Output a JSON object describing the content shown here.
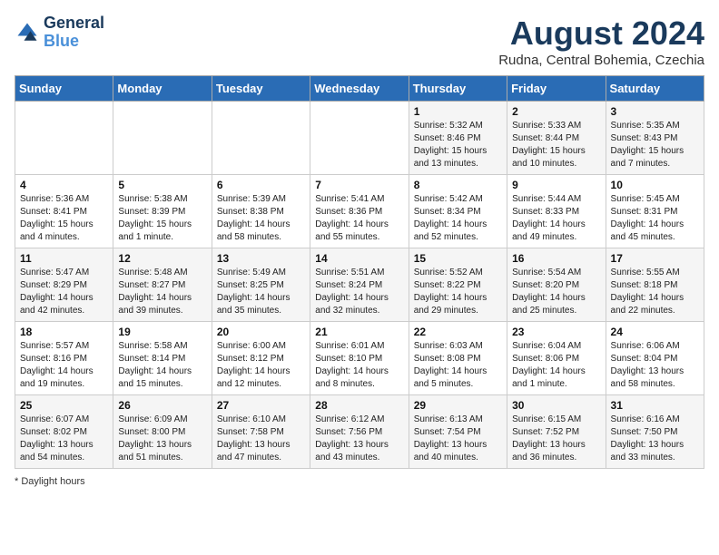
{
  "header": {
    "logo_line1": "General",
    "logo_line2": "Blue",
    "month_year": "August 2024",
    "location": "Rudna, Central Bohemia, Czechia"
  },
  "days_of_week": [
    "Sunday",
    "Monday",
    "Tuesday",
    "Wednesday",
    "Thursday",
    "Friday",
    "Saturday"
  ],
  "weeks": [
    [
      {
        "day": "",
        "info": ""
      },
      {
        "day": "",
        "info": ""
      },
      {
        "day": "",
        "info": ""
      },
      {
        "day": "",
        "info": ""
      },
      {
        "day": "1",
        "info": "Sunrise: 5:32 AM\nSunset: 8:46 PM\nDaylight: 15 hours\nand 13 minutes."
      },
      {
        "day": "2",
        "info": "Sunrise: 5:33 AM\nSunset: 8:44 PM\nDaylight: 15 hours\nand 10 minutes."
      },
      {
        "day": "3",
        "info": "Sunrise: 5:35 AM\nSunset: 8:43 PM\nDaylight: 15 hours\nand 7 minutes."
      }
    ],
    [
      {
        "day": "4",
        "info": "Sunrise: 5:36 AM\nSunset: 8:41 PM\nDaylight: 15 hours\nand 4 minutes."
      },
      {
        "day": "5",
        "info": "Sunrise: 5:38 AM\nSunset: 8:39 PM\nDaylight: 15 hours\nand 1 minute."
      },
      {
        "day": "6",
        "info": "Sunrise: 5:39 AM\nSunset: 8:38 PM\nDaylight: 14 hours\nand 58 minutes."
      },
      {
        "day": "7",
        "info": "Sunrise: 5:41 AM\nSunset: 8:36 PM\nDaylight: 14 hours\nand 55 minutes."
      },
      {
        "day": "8",
        "info": "Sunrise: 5:42 AM\nSunset: 8:34 PM\nDaylight: 14 hours\nand 52 minutes."
      },
      {
        "day": "9",
        "info": "Sunrise: 5:44 AM\nSunset: 8:33 PM\nDaylight: 14 hours\nand 49 minutes."
      },
      {
        "day": "10",
        "info": "Sunrise: 5:45 AM\nSunset: 8:31 PM\nDaylight: 14 hours\nand 45 minutes."
      }
    ],
    [
      {
        "day": "11",
        "info": "Sunrise: 5:47 AM\nSunset: 8:29 PM\nDaylight: 14 hours\nand 42 minutes."
      },
      {
        "day": "12",
        "info": "Sunrise: 5:48 AM\nSunset: 8:27 PM\nDaylight: 14 hours\nand 39 minutes."
      },
      {
        "day": "13",
        "info": "Sunrise: 5:49 AM\nSunset: 8:25 PM\nDaylight: 14 hours\nand 35 minutes."
      },
      {
        "day": "14",
        "info": "Sunrise: 5:51 AM\nSunset: 8:24 PM\nDaylight: 14 hours\nand 32 minutes."
      },
      {
        "day": "15",
        "info": "Sunrise: 5:52 AM\nSunset: 8:22 PM\nDaylight: 14 hours\nand 29 minutes."
      },
      {
        "day": "16",
        "info": "Sunrise: 5:54 AM\nSunset: 8:20 PM\nDaylight: 14 hours\nand 25 minutes."
      },
      {
        "day": "17",
        "info": "Sunrise: 5:55 AM\nSunset: 8:18 PM\nDaylight: 14 hours\nand 22 minutes."
      }
    ],
    [
      {
        "day": "18",
        "info": "Sunrise: 5:57 AM\nSunset: 8:16 PM\nDaylight: 14 hours\nand 19 minutes."
      },
      {
        "day": "19",
        "info": "Sunrise: 5:58 AM\nSunset: 8:14 PM\nDaylight: 14 hours\nand 15 minutes."
      },
      {
        "day": "20",
        "info": "Sunrise: 6:00 AM\nSunset: 8:12 PM\nDaylight: 14 hours\nand 12 minutes."
      },
      {
        "day": "21",
        "info": "Sunrise: 6:01 AM\nSunset: 8:10 PM\nDaylight: 14 hours\nand 8 minutes."
      },
      {
        "day": "22",
        "info": "Sunrise: 6:03 AM\nSunset: 8:08 PM\nDaylight: 14 hours\nand 5 minutes."
      },
      {
        "day": "23",
        "info": "Sunrise: 6:04 AM\nSunset: 8:06 PM\nDaylight: 14 hours\nand 1 minute."
      },
      {
        "day": "24",
        "info": "Sunrise: 6:06 AM\nSunset: 8:04 PM\nDaylight: 13 hours\nand 58 minutes."
      }
    ],
    [
      {
        "day": "25",
        "info": "Sunrise: 6:07 AM\nSunset: 8:02 PM\nDaylight: 13 hours\nand 54 minutes."
      },
      {
        "day": "26",
        "info": "Sunrise: 6:09 AM\nSunset: 8:00 PM\nDaylight: 13 hours\nand 51 minutes."
      },
      {
        "day": "27",
        "info": "Sunrise: 6:10 AM\nSunset: 7:58 PM\nDaylight: 13 hours\nand 47 minutes."
      },
      {
        "day": "28",
        "info": "Sunrise: 6:12 AM\nSunset: 7:56 PM\nDaylight: 13 hours\nand 43 minutes."
      },
      {
        "day": "29",
        "info": "Sunrise: 6:13 AM\nSunset: 7:54 PM\nDaylight: 13 hours\nand 40 minutes."
      },
      {
        "day": "30",
        "info": "Sunrise: 6:15 AM\nSunset: 7:52 PM\nDaylight: 13 hours\nand 36 minutes."
      },
      {
        "day": "31",
        "info": "Sunrise: 6:16 AM\nSunset: 7:50 PM\nDaylight: 13 hours\nand 33 minutes."
      }
    ]
  ],
  "footer": {
    "note": "Daylight hours"
  }
}
